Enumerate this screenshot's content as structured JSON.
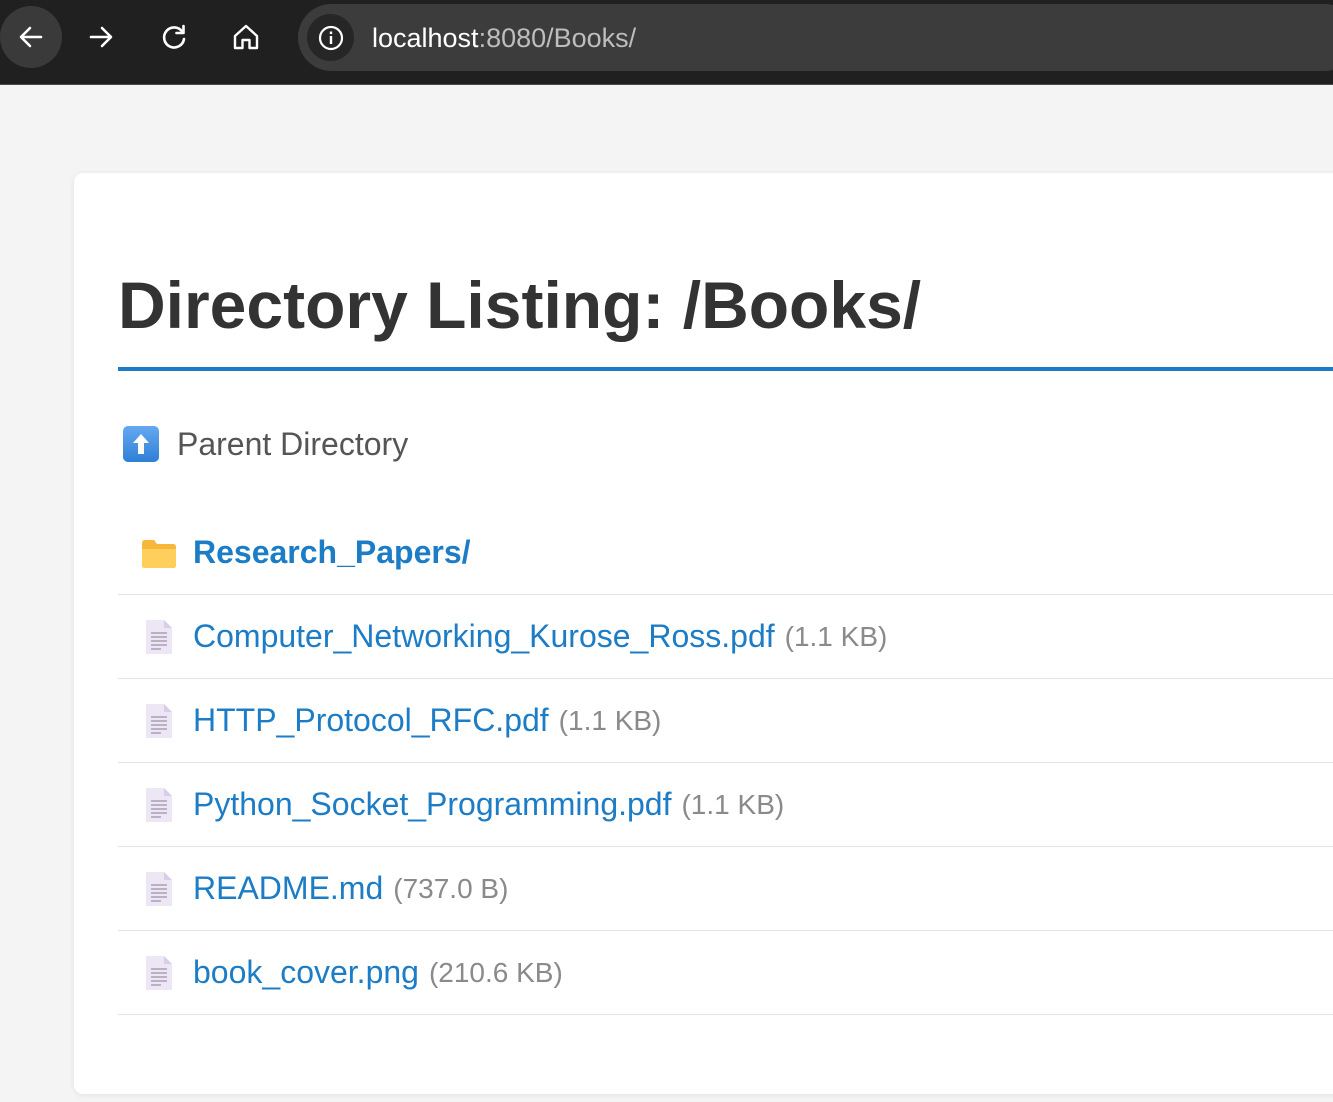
{
  "browser": {
    "url_host": "localhost",
    "url_rest": ":8080/Books/"
  },
  "page": {
    "heading": "Directory Listing: /Books/",
    "parent_label": "Parent Directory"
  },
  "entries": [
    {
      "name": "Research_Papers/",
      "type": "folder",
      "size": ""
    },
    {
      "name": "Computer_Networking_Kurose_Ross.pdf",
      "type": "file",
      "size": "(1.1 KB)"
    },
    {
      "name": "HTTP_Protocol_RFC.pdf",
      "type": "file",
      "size": "(1.1 KB)"
    },
    {
      "name": "Python_Socket_Programming.pdf",
      "type": "file",
      "size": "(1.1 KB)"
    },
    {
      "name": "README.md",
      "type": "file",
      "size": "(737.0 B)"
    },
    {
      "name": "book_cover.png",
      "type": "file",
      "size": "(210.6 KB)"
    }
  ],
  "icons": {
    "back": "arrow-left-icon",
    "forward": "arrow-right-icon",
    "reload": "reload-icon",
    "home": "home-icon",
    "site_info": "info-icon",
    "parent": "up-arrow-icon",
    "folder": "folder-icon",
    "file": "document-icon"
  },
  "colors": {
    "link": "#1c7cc5",
    "heading": "#333333",
    "muted": "#8a8a8a",
    "toolbar": "#202020"
  }
}
